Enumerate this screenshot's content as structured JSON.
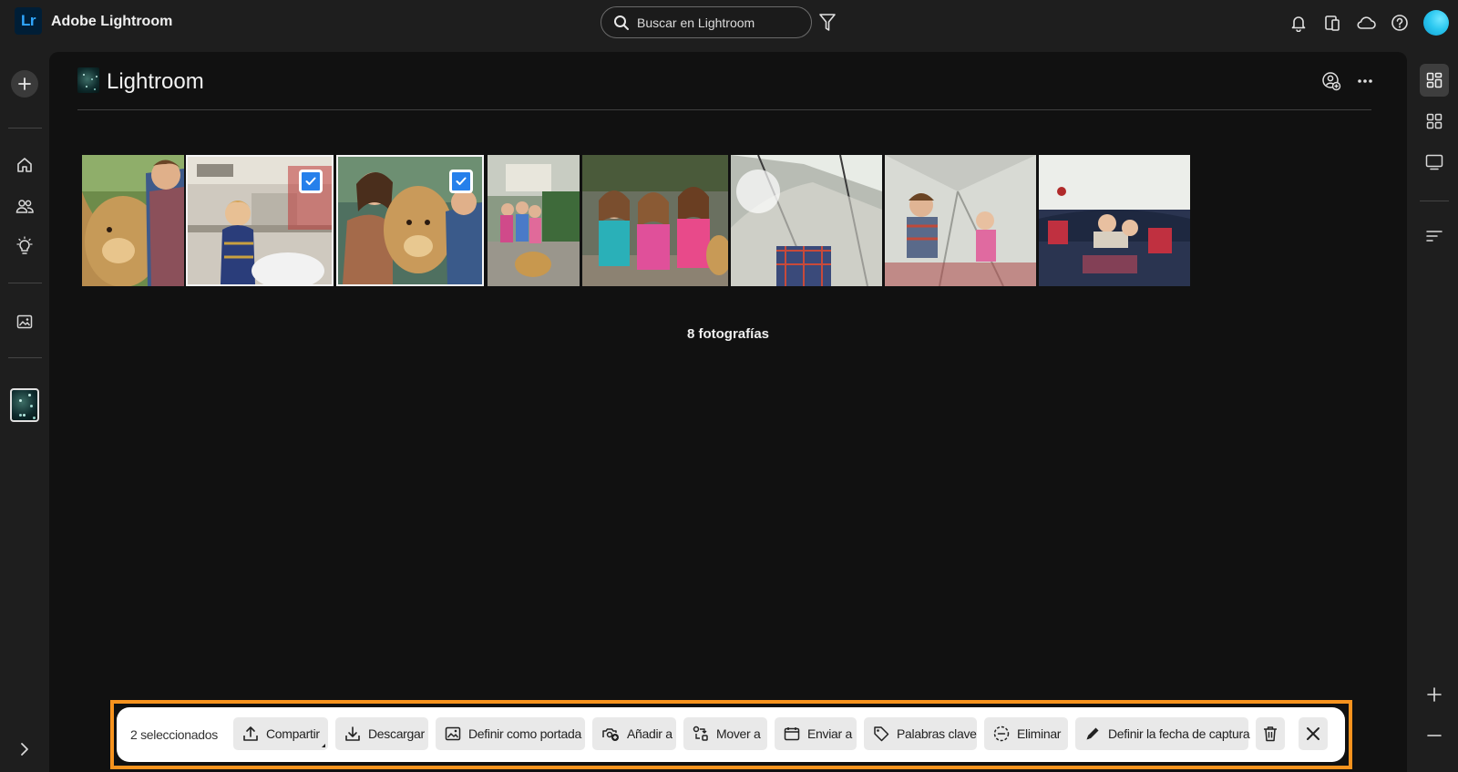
{
  "app": {
    "logo": "Lr",
    "title": "Adobe Lightroom"
  },
  "search": {
    "placeholder": "Buscar en Lightroom"
  },
  "album": {
    "title": "Lightroom",
    "photo_count_label": "8 fotografías"
  },
  "photos": [
    {
      "name": "photo-boy-with-dog",
      "selected": false
    },
    {
      "name": "photo-boy-in-kitchen",
      "selected": true
    },
    {
      "name": "photo-girl-boy-golden-retriever",
      "selected": true
    },
    {
      "name": "photo-girls-with-dog-on-steps",
      "selected": false
    },
    {
      "name": "photo-three-girls-smiling",
      "selected": false
    },
    {
      "name": "photo-tent-from-inside",
      "selected": false
    },
    {
      "name": "photo-kids-in-tent",
      "selected": false
    },
    {
      "name": "photo-kids-on-sofa",
      "selected": false
    }
  ],
  "action_bar": {
    "selection_label": "2 seleccionados",
    "buttons": {
      "share": "Compartir",
      "download": "Descargar",
      "set_cover": "Definir como portada",
      "add_to": "Añadir a",
      "move_to": "Mover a",
      "send_to": "Enviar a",
      "keywords": "Palabras clave",
      "remove": "Eliminar",
      "set_capture_date": "Definir la fecha de captura"
    }
  },
  "colors": {
    "accent": "#2680eb",
    "highlight_frame": "#f7931e",
    "logo_bg": "#001e36",
    "logo_text": "#31a8ff"
  },
  "icons": [
    "search-icon",
    "filter-icon",
    "bell-icon",
    "devices-icon",
    "cloud-icon",
    "help-icon",
    "plus-icon",
    "home-icon",
    "people-icon",
    "lightbulb-icon",
    "photo-icon",
    "chevron-right-icon",
    "share-person-icon",
    "more-icon",
    "grid-view-icon",
    "square-grid-icon",
    "detail-view-icon",
    "sort-icon",
    "upload-icon",
    "download-icon",
    "image-icon",
    "add-to-album-icon",
    "move-icon",
    "send-icon",
    "tag-icon",
    "remove-icon",
    "pencil-icon",
    "trash-icon",
    "close-icon"
  ]
}
